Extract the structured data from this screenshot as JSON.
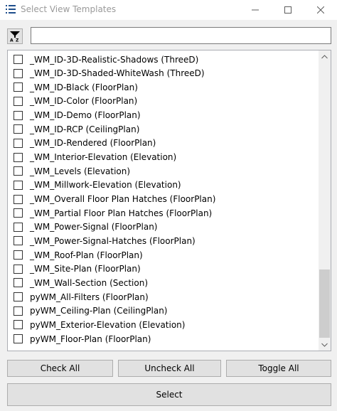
{
  "window": {
    "title": "Select View Templates",
    "icons": {
      "app": "list-icon",
      "minimize": "minimize-icon",
      "maximize": "maximize-icon",
      "close": "close-icon",
      "sort": "sort-az-filter-icon"
    }
  },
  "search": {
    "value": "",
    "placeholder": ""
  },
  "templates": [
    "_WM_ID-3D-Realistic-Shadows (ThreeD)",
    "_WM_ID-3D-Shaded-WhiteWash (ThreeD)",
    "_WM_ID-Black (FloorPlan)",
    "_WM_ID-Color (FloorPlan)",
    "_WM_ID-Demo (FloorPlan)",
    "_WM_ID-RCP (CeilingPlan)",
    "_WM_ID-Rendered (FloorPlan)",
    "_WM_Interior-Elevation (Elevation)",
    "_WM_Levels (Elevation)",
    "_WM_Millwork-Elevation (Elevation)",
    "_WM_Overall Floor Plan Hatches (FloorPlan)",
    "_WM_Partial Floor Plan Hatches (FloorPlan)",
    "_WM_Power-Signal (FloorPlan)",
    "_WM_Power-Signal-Hatches (FloorPlan)",
    "_WM_Roof-Plan (FloorPlan)",
    "_WM_Site-Plan (FloorPlan)",
    "_WM_Wall-Section (Section)",
    "pyWM_All-Filters (FloorPlan)",
    "pyWM_Ceiling-Plan (CeilingPlan)",
    "pyWM_Exterior-Elevation (Elevation)",
    "pyWM_Floor-Plan (FloorPlan)"
  ],
  "buttons": {
    "check_all": "Check All",
    "uncheck_all": "Uncheck All",
    "toggle_all": "Toggle All",
    "select": "Select"
  }
}
